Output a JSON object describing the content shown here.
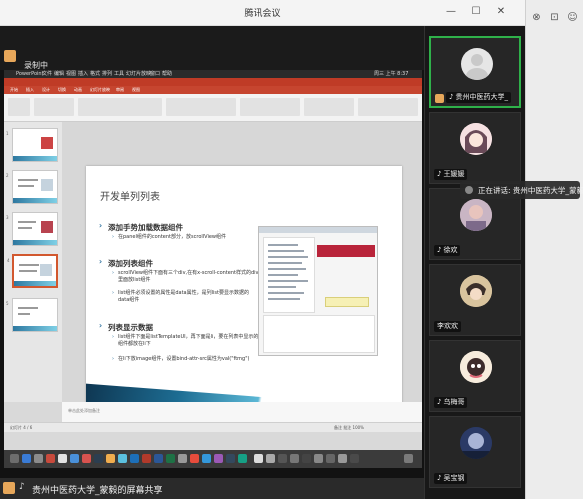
{
  "window": {
    "title": "腾讯会议",
    "controls": {
      "minimize": "—",
      "maximize": "☐",
      "close": "✕"
    },
    "extra_icons": [
      "pin-icon",
      "layout-icon",
      "people-icon"
    ]
  },
  "share": {
    "sharer_short": "录制中",
    "banner_text": "贵州中医药大学_蒙毅的屏幕共享"
  },
  "mac": {
    "menus": [
      "PowerPoint",
      "文件",
      "编辑",
      "视图",
      "插入",
      "格式",
      "排列",
      "工具",
      "幻灯片放映",
      "窗口",
      "帮助"
    ],
    "clock": "周三 上午 8:37"
  },
  "ppt": {
    "tabs": [
      "开始",
      "插入",
      "设计",
      "切换",
      "动画",
      "幻灯片放映",
      "审阅",
      "视图"
    ],
    "status_left": "幻灯片 4 / 6",
    "status_right": "备注   批注   100%",
    "notes_placeholder": "单击此处添加备注",
    "slide": {
      "title": "开发单列列表",
      "sections": [
        {
          "head": "添加手势加载数据组件",
          "items": [
            "在panel组件的content部分，放scrollView组件"
          ]
        },
        {
          "head": "添加列表组件",
          "items": [
            "scrollView组件下面有三个div,在有x-scroll-content样式的div里面放list组件",
            "list组件必须设置的属性是data属性，是列list要显示数据的data组件"
          ]
        },
        {
          "head": "列表显示数据",
          "items": [
            "list组件下面是listTemplateUI，再下面是li，要在列表中显示的组件都放在li下",
            "在li下放image组件，设置bind-attr-src属性为val(\"ftmg\")"
          ]
        }
      ]
    },
    "slide_numbers": [
      "1",
      "2",
      "3",
      "4",
      "5"
    ]
  },
  "participants": [
    {
      "name": "贵州中医药大学_",
      "host": true,
      "speaking": true,
      "avatar": "default-avatar"
    },
    {
      "name": "王媛媛",
      "avatar": "anime-girl-avatar"
    },
    {
      "name": "徐欢",
      "avatar": "photo-avatar"
    },
    {
      "name": "李欢欢",
      "avatar": "anime-boy-avatar"
    },
    {
      "name": "乌梅哥",
      "avatar": "cartoon-avatar"
    },
    {
      "name": "吴宝钢",
      "avatar": "night-sky-avatar"
    }
  ],
  "speaking_tip": "正在讲话: 贵州中医药大学_蒙毅",
  "colors": {
    "ppt_accent": "#bf3b26",
    "speaking_border": "#2fb14a",
    "host_badge": "#e7a75a",
    "slide_accent": "#2b6f9c"
  }
}
